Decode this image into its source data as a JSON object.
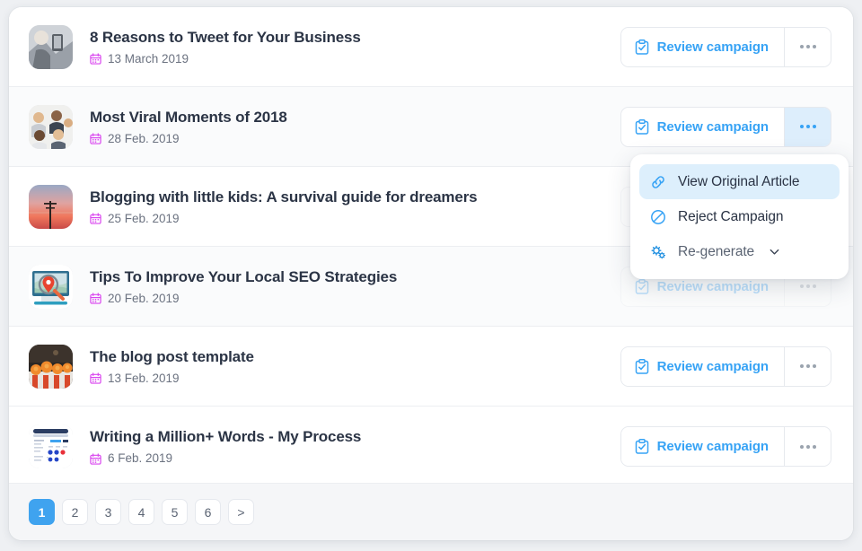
{
  "rows": [
    {
      "title": "8 Reasons to Tweet for Your Business",
      "date": "13 March 2019",
      "thumb": "person-with-phone"
    },
    {
      "title": "Most Viral Moments of 2018",
      "date": "28 Feb. 2019",
      "thumb": "group-of-people"
    },
    {
      "title": "Blogging with little kids: A survival guide for dreamers",
      "date": "25 Feb. 2019",
      "thumb": "sunset-pole"
    },
    {
      "title": "Tips To Improve Your Local SEO Strategies",
      "date": "20 Feb. 2019",
      "thumb": "map-pin-screen"
    },
    {
      "title": "The blog post template",
      "date": "13 Feb. 2019",
      "thumb": "orange-flowers"
    },
    {
      "title": "Writing a Million+ Words - My Process",
      "date": "6 Feb. 2019",
      "thumb": "dashboard-ui"
    }
  ],
  "actions": {
    "review_label": "Review campaign",
    "review_icon": "clipboard-check-icon",
    "more_icon": "ellipsis-icon"
  },
  "dropdown": {
    "items": [
      {
        "label": "View Original Article",
        "icon": "link-icon",
        "highlighted": true,
        "chevron": false
      },
      {
        "label": "Reject Campaign",
        "icon": "ban-icon",
        "highlighted": false,
        "chevron": false
      },
      {
        "label": "Re-generate",
        "icon": "cogs-icon",
        "highlighted": false,
        "chevron": true
      }
    ],
    "chevron_icon": "chevron-down-icon"
  },
  "pagination": {
    "pages": [
      "1",
      "2",
      "3",
      "4",
      "5",
      "6"
    ],
    "active": "1",
    "next_label": ">"
  },
  "colors": {
    "accent_blue": "#37a3f5",
    "active_page": "#3fa3ef",
    "highlight_bg": "#ddeffc",
    "title": "#2b3445",
    "date": "#6b7280",
    "calendar_icon": "#d946ef"
  }
}
